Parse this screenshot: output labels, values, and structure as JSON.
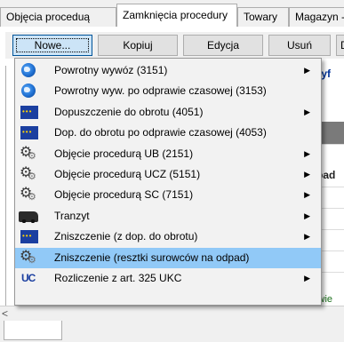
{
  "tabs": [
    {
      "label": "Objęcia proceduą",
      "active": false
    },
    {
      "label": "Zamknięcia procedury",
      "active": true
    },
    {
      "label": "Towary",
      "active": false
    },
    {
      "label": "Magazyn -",
      "active": false
    }
  ],
  "toolbar": {
    "nowe": "Nowe...",
    "kopiuj": "Kopiuj",
    "edycja": "Edycja",
    "usun": "Usuń",
    "doe": "Do e"
  },
  "background": {
    "cell_a": "ntyf",
    "cell_pad": "pad",
    "cell_swie": "świe"
  },
  "menu": {
    "items": [
      {
        "label": "Powrotny wywóz (3151)",
        "icon": "globe-icon",
        "submenu": true,
        "highlighted": false
      },
      {
        "label": "Powrotny wyw.  po odprawie czasowej (3153)",
        "icon": "globe-icon",
        "submenu": false,
        "highlighted": false
      },
      {
        "label": "Dopuszczenie do obrotu (4051)",
        "icon": "eu-flag-icon",
        "submenu": true,
        "highlighted": false
      },
      {
        "label": "Dop. do obrotu po odprawie czasowej (4053)",
        "icon": "eu-flag-icon",
        "submenu": false,
        "highlighted": false
      },
      {
        "label": "Objęcie procedurą UB (2151)",
        "icon": "gears-icon",
        "submenu": true,
        "highlighted": false
      },
      {
        "label": "Objęcie procedurą UCZ (5151)",
        "icon": "gears-icon",
        "submenu": true,
        "highlighted": false
      },
      {
        "label": "Objęcie procedurą SC (7151)",
        "icon": "gears-icon",
        "submenu": true,
        "highlighted": false
      },
      {
        "label": "Tranzyt",
        "icon": "truck-icon",
        "submenu": true,
        "highlighted": false
      },
      {
        "label": "Zniszczenie (z dop. do obrotu)",
        "icon": "eu-flag-icon",
        "submenu": true,
        "highlighted": false
      },
      {
        "label": "Zniszczenie (resztki surowców na odpad)",
        "icon": "gears-icon",
        "submenu": false,
        "highlighted": true
      },
      {
        "label": "Rozliczenie z art. 325 UKC",
        "icon": "uc-icon",
        "submenu": true,
        "highlighted": false
      }
    ]
  },
  "submenu_arrow": "▶",
  "scroll_arrow": "<",
  "colors": {
    "highlight": "#91c9f7",
    "pressed_button": "#cce4f7",
    "eu_blue": "#1b3fa0"
  }
}
